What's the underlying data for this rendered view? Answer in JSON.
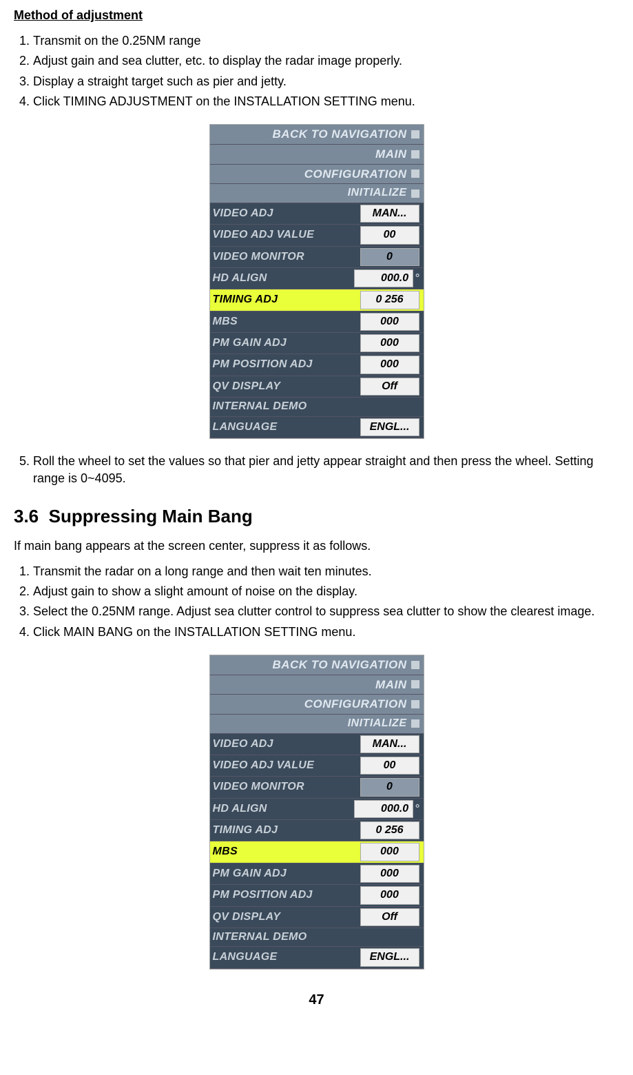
{
  "heading1": "Method of adjustment",
  "list1": [
    "Transmit on the 0.25NM range",
    "Adjust gain and sea clutter, etc. to display the radar image properly.",
    "Display a straight target such as pier and jetty.",
    "Click TIMING ADJUSTMENT on the INSTALLATION SETTING menu."
  ],
  "menu1": {
    "headers": [
      "BACK TO NAVIGATION",
      "MAIN",
      "CONFIGURATION",
      "INITIALIZE"
    ],
    "rows": [
      {
        "label": "VIDEO ADJ",
        "value": "MAN...",
        "cls": ""
      },
      {
        "label": "VIDEO ADJ VALUE",
        "value": "00",
        "cls": ""
      },
      {
        "label": "VIDEO MONITOR",
        "value": "0",
        "cls": "disabled"
      },
      {
        "label": "HD ALIGN",
        "value": "000.0",
        "suffix": "°",
        "cls": ""
      },
      {
        "label": "TIMING ADJ",
        "value": "0 256",
        "cls": "",
        "highlight": true
      },
      {
        "label": "MBS",
        "value": "000",
        "cls": ""
      },
      {
        "label": "PM GAIN ADJ",
        "value": "000",
        "cls": ""
      },
      {
        "label": "PM POSITION ADJ",
        "value": "000",
        "cls": ""
      },
      {
        "label": "QV DISPLAY",
        "value": "Off",
        "cls": ""
      },
      {
        "label": "INTERNAL DEMO",
        "value": "",
        "cls": "plain"
      },
      {
        "label": "LANGUAGE",
        "value": "ENGL...",
        "cls": ""
      }
    ]
  },
  "list1b": [
    "Roll the wheel to set the values so that pier and jetty appear straight and then press the wheel. Setting range is 0~4095."
  ],
  "section_number": "3.6",
  "section_title": "Suppressing Main Bang",
  "section_intro": "If main bang appears at the screen center, suppress it as follows.",
  "list2": [
    "Transmit the radar on a long range and then wait ten minutes.",
    "Adjust gain to show a slight amount of noise on the display.",
    "Select the 0.25NM range. Adjust sea clutter control to suppress sea clutter to show the clearest image.",
    "Click MAIN BANG on the INSTALLATION SETTING menu."
  ],
  "menu2": {
    "headers": [
      "BACK TO NAVIGATION",
      "MAIN",
      "CONFIGURATION",
      "INITIALIZE"
    ],
    "rows": [
      {
        "label": "VIDEO ADJ",
        "value": "MAN...",
        "cls": ""
      },
      {
        "label": "VIDEO ADJ VALUE",
        "value": "00",
        "cls": ""
      },
      {
        "label": "VIDEO MONITOR",
        "value": "0",
        "cls": "disabled"
      },
      {
        "label": "HD ALIGN",
        "value": "000.0",
        "suffix": "°",
        "cls": ""
      },
      {
        "label": "TIMING ADJ",
        "value": "0 256",
        "cls": ""
      },
      {
        "label": "MBS",
        "value": "000",
        "cls": "",
        "highlight": true
      },
      {
        "label": "PM GAIN ADJ",
        "value": "000",
        "cls": ""
      },
      {
        "label": "PM POSITION ADJ",
        "value": "000",
        "cls": ""
      },
      {
        "label": "QV DISPLAY",
        "value": "Off",
        "cls": ""
      },
      {
        "label": "INTERNAL DEMO",
        "value": "",
        "cls": "plain"
      },
      {
        "label": "LANGUAGE",
        "value": "ENGL...",
        "cls": ""
      }
    ]
  },
  "page_number": "47"
}
